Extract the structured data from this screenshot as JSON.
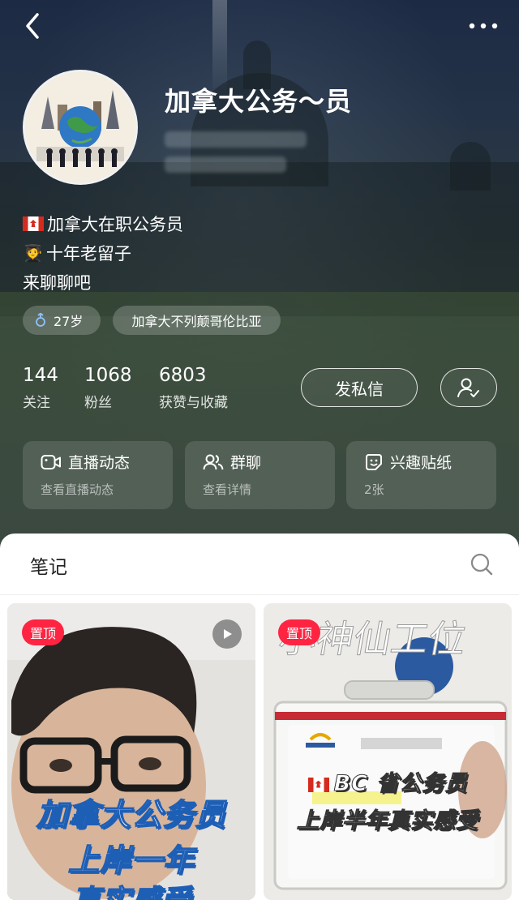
{
  "profile": {
    "name": "加拿大公务～员",
    "bio": [
      "加拿大在职公务员",
      "十年老留子",
      "来聊聊吧"
    ],
    "tags": {
      "age": "27岁",
      "location": "加拿大不列颠哥伦比亚"
    }
  },
  "stats": [
    {
      "value": "144",
      "label": "关注"
    },
    {
      "value": "1068",
      "label": "粉丝"
    },
    {
      "value": "6803",
      "label": "获赞与收藏"
    }
  ],
  "actions": {
    "message": "发私信"
  },
  "cards": [
    {
      "title": "直播动态",
      "subtitle": "查看直播动态",
      "icon": "video-icon"
    },
    {
      "title": "群聊",
      "subtitle": "查看详情",
      "icon": "group-icon"
    },
    {
      "title": "兴趣贴纸",
      "subtitle": "2张",
      "icon": "sticker-icon"
    }
  ],
  "notes": {
    "tab": "笔记",
    "items": [
      {
        "pin": "置顶",
        "lines": [
          "加拿大公务员",
          "上岸一年",
          "真实感受"
        ],
        "type": "video"
      },
      {
        "pin": "置顶",
        "lines": [
          "BC 省公务员",
          "上岸半年真实感受"
        ],
        "handwriting": "小神仙工位"
      }
    ]
  },
  "colors": {
    "accent": "#ff2442",
    "sheet": "#ffffff"
  }
}
